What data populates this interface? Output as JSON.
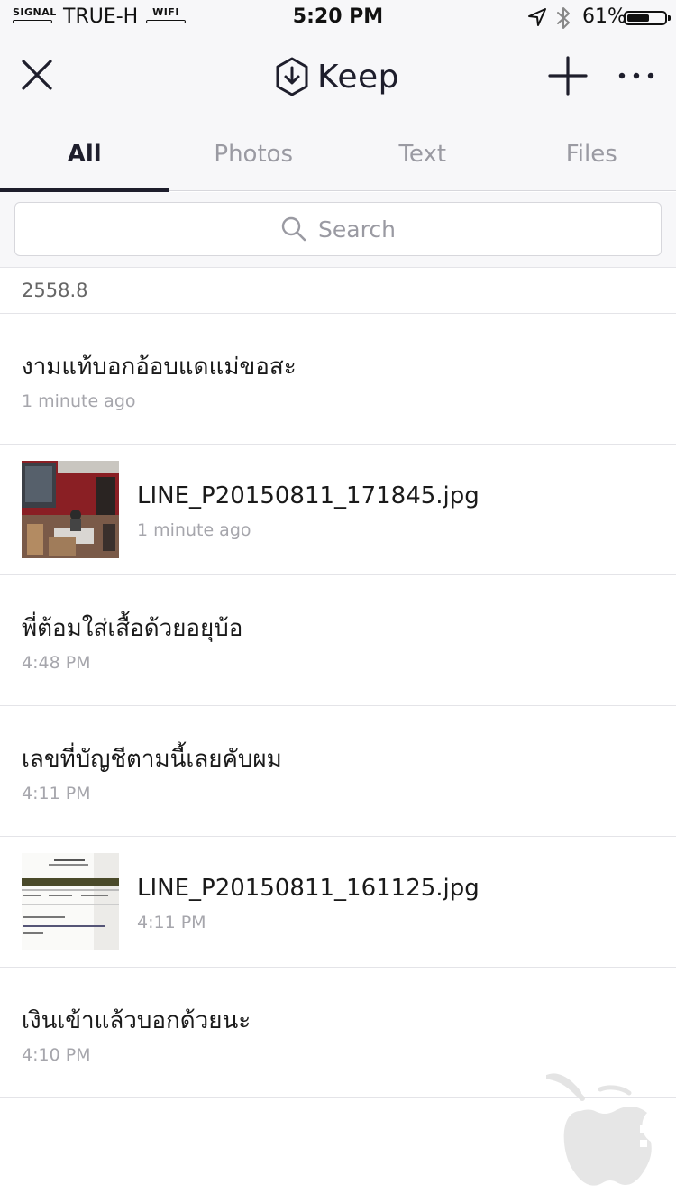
{
  "status_bar": {
    "signal_label": "SIGNAL",
    "carrier": "TRUE-H",
    "wifi_label": "WIFI",
    "time": "5:20 PM",
    "battery_percent": "61%",
    "battery_level": 0.61
  },
  "header": {
    "app_name": "Keep",
    "close_icon": "close-icon",
    "add_icon": "plus-icon",
    "more_icon": "more-icon"
  },
  "tabs": [
    {
      "label": "All",
      "active": true
    },
    {
      "label": "Photos",
      "active": false
    },
    {
      "label": "Text",
      "active": false
    },
    {
      "label": "Files",
      "active": false
    }
  ],
  "search": {
    "placeholder": "Search"
  },
  "section": {
    "label": "2558.8"
  },
  "items": [
    {
      "type": "text",
      "title": "งามแท้บอกอ้อบแดแม่ขอสะ",
      "time": "1 minute ago"
    },
    {
      "type": "file",
      "title": "LINE_P20150811_171845.jpg",
      "time": "1 minute ago"
    },
    {
      "type": "text",
      "title": "พี่ต้อมใส่เสื้อด้วยอยุบ้อ",
      "time": "4:48 PM"
    },
    {
      "type": "text",
      "title": "เลขที่บัญชีตามนี้เลยคับผม",
      "time": "4:11 PM"
    },
    {
      "type": "file",
      "title": "LINE_P20150811_161125.jpg",
      "time": "4:11 PM"
    },
    {
      "type": "text",
      "title": "เงินเข้าแล้วบอกด้วยนะ",
      "time": "4:10 PM"
    }
  ],
  "colors": {
    "accent": "#1e1e2c",
    "header_bg": "#f7f7f9",
    "muted_text": "#a6a6ac"
  }
}
